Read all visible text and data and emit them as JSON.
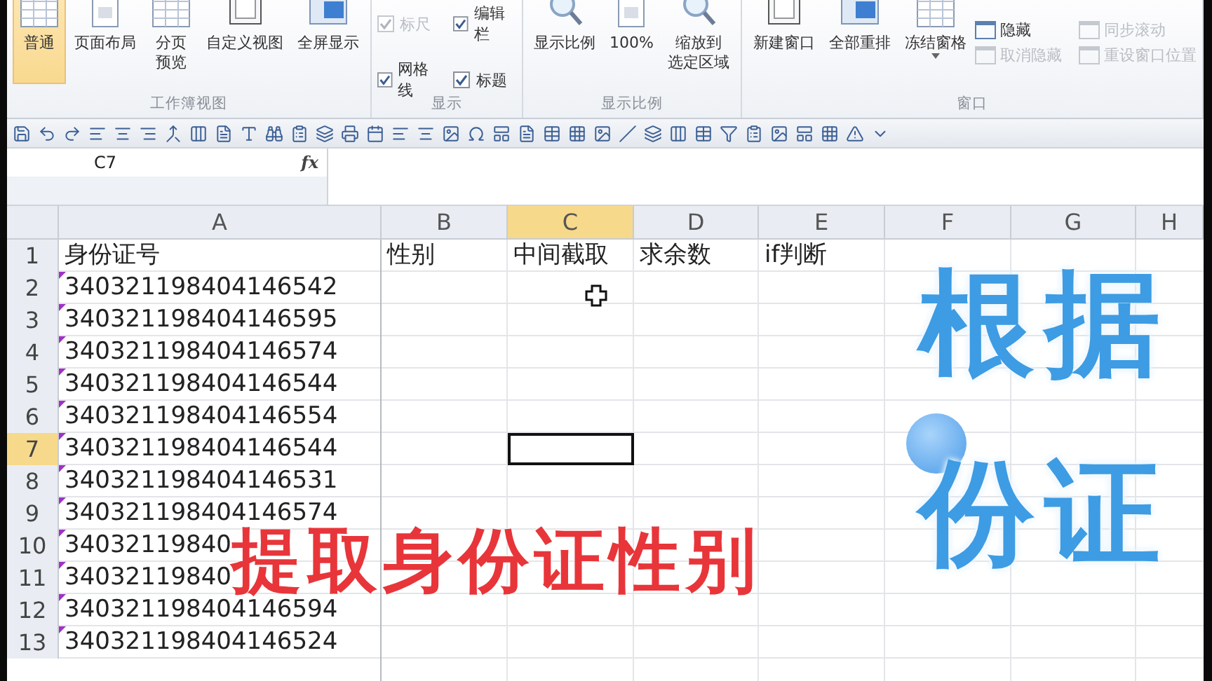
{
  "ribbon": {
    "groups": [
      {
        "label": "工作簿视图",
        "items": [
          {
            "kind": "big",
            "lines": [
              "普通"
            ],
            "selected": true
          },
          {
            "kind": "big",
            "lines": [
              "页面布局"
            ],
            "selected": false
          },
          {
            "kind": "big",
            "lines": [
              "分页",
              "预览"
            ],
            "selected": false
          },
          {
            "kind": "big",
            "lines": [
              "自定义视图"
            ],
            "selected": false
          },
          {
            "kind": "big",
            "lines": [
              "全屏显示"
            ],
            "selected": false
          }
        ]
      },
      {
        "label": "显示",
        "items": [
          {
            "kind": "check",
            "label": "标尺",
            "checked": true,
            "disabled": true
          },
          {
            "kind": "check",
            "label": "编辑栏",
            "checked": true,
            "disabled": false
          },
          {
            "kind": "check",
            "label": "网格线",
            "checked": true,
            "disabled": false
          },
          {
            "kind": "check",
            "label": "标题",
            "checked": true,
            "disabled": false
          }
        ]
      },
      {
        "label": "显示比例",
        "items": [
          {
            "kind": "big",
            "lines": [
              "显示比例"
            ],
            "selected": false
          },
          {
            "kind": "big",
            "lines": [
              "100%"
            ],
            "selected": false
          },
          {
            "kind": "big",
            "lines": [
              "缩放到",
              "选定区域"
            ],
            "selected": false
          }
        ]
      },
      {
        "label": "窗口",
        "items": [
          {
            "kind": "big",
            "lines": [
              "新建窗口"
            ],
            "selected": false
          },
          {
            "kind": "big",
            "lines": [
              "全部重排"
            ],
            "selected": false
          },
          {
            "kind": "big",
            "lines": [
              "冻结窗格"
            ],
            "selected": false,
            "dropdown": true
          },
          {
            "kind": "small",
            "label": "隐藏",
            "disabled": false
          },
          {
            "kind": "small",
            "label": "取消隐藏",
            "disabled": true
          },
          {
            "kind": "small",
            "label": "同步滚动",
            "disabled": true
          },
          {
            "kind": "small",
            "label": "重设窗口位置",
            "disabled": true
          }
        ]
      }
    ]
  },
  "name_box": "C7",
  "formula_label": "fx",
  "columns": [
    {
      "label": "A",
      "selected": false
    },
    {
      "label": "B",
      "selected": false
    },
    {
      "label": "C",
      "selected": true
    },
    {
      "label": "D",
      "selected": false
    },
    {
      "label": "E",
      "selected": false
    },
    {
      "label": "F",
      "selected": false
    },
    {
      "label": "G",
      "selected": false
    },
    {
      "label": "H",
      "selected": false
    }
  ],
  "rows": [
    {
      "header": "1",
      "selected": false,
      "cells": [
        "身份证号",
        "性别",
        "中间截取",
        "求余数",
        "if判断"
      ]
    },
    {
      "header": "2",
      "selected": false,
      "flagged": true,
      "cells": [
        "340321198404146542"
      ]
    },
    {
      "header": "3",
      "selected": false,
      "flagged": true,
      "cells": [
        "340321198404146595"
      ]
    },
    {
      "header": "4",
      "selected": false,
      "flagged": true,
      "cells": [
        "340321198404146574"
      ]
    },
    {
      "header": "5",
      "selected": false,
      "flagged": true,
      "cells": [
        "340321198404146544"
      ]
    },
    {
      "header": "6",
      "selected": false,
      "flagged": true,
      "cells": [
        "340321198404146554"
      ]
    },
    {
      "header": "7",
      "selected": true,
      "flagged": true,
      "cells": [
        "340321198404146544"
      ]
    },
    {
      "header": "8",
      "selected": false,
      "flagged": true,
      "cells": [
        "340321198404146531"
      ]
    },
    {
      "header": "9",
      "selected": false,
      "flagged": true,
      "cells": [
        "340321198404146574"
      ]
    },
    {
      "header": "10",
      "selected": false,
      "flagged": true,
      "cells": [
        "34032119840"
      ]
    },
    {
      "header": "11",
      "selected": false,
      "flagged": true,
      "cells": [
        "34032119840"
      ]
    },
    {
      "header": "12",
      "selected": false,
      "flagged": true,
      "cells": [
        "340321198404146594"
      ]
    },
    {
      "header": "13",
      "selected": false,
      "flagged": true,
      "cells": [
        "340321198404146524"
      ]
    }
  ],
  "caption": "提取身份证性别",
  "side_title": [
    "根据",
    "份证"
  ]
}
